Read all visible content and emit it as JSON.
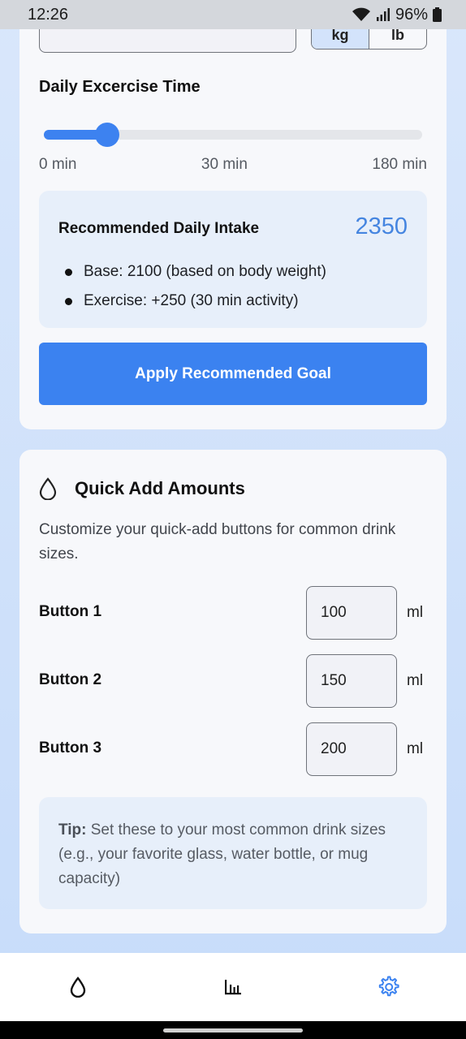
{
  "status_bar": {
    "time": "12:26",
    "battery": "96%"
  },
  "goal_card": {
    "weight_units": [
      "kg",
      "lb"
    ],
    "exercise_label": "Daily Excercise Time",
    "slider": {
      "min_label": "0 min",
      "mid_label": "30 min",
      "max_label": "180 min",
      "value_fraction": 0.167
    },
    "intake": {
      "title": "Recommended Daily Intake",
      "value": "2350",
      "items": [
        "Base: 2100 (based on body weight)",
        "Exercise: +250 (30 min activity)"
      ]
    },
    "apply_button": "Apply Recommended Goal"
  },
  "quick_add": {
    "icon": "water-drop-icon",
    "title": "Quick Add Amounts",
    "description": "Customize your quick-add buttons for common drink sizes.",
    "rows": [
      {
        "label": "Button 1",
        "value": "100",
        "unit": "ml"
      },
      {
        "label": "Button 2",
        "value": "150",
        "unit": "ml"
      },
      {
        "label": "Button 3",
        "value": "200",
        "unit": "ml"
      }
    ],
    "tip_label": "Tip:",
    "tip_text": " Set these to your most common drink sizes (e.g., your favorite glass, water bottle, or mug capacity)"
  },
  "bottom_nav": {
    "items": [
      {
        "icon": "water-drop-icon",
        "active": false
      },
      {
        "icon": "bar-chart-icon",
        "active": false
      },
      {
        "icon": "gear-icon",
        "active": true
      }
    ],
    "active_color": "#3b82f0"
  },
  "colors": {
    "accent": "#3b82f0",
    "intake_value": "#4585e0"
  }
}
